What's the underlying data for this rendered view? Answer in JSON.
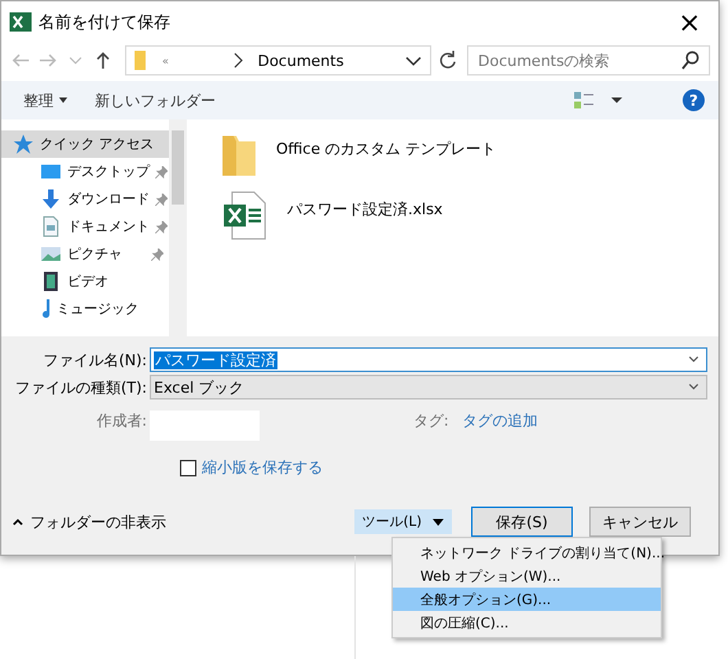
{
  "window": {
    "title": "名前を付けて保存",
    "close": "×"
  },
  "address": {
    "prefix": "«",
    "path": "Documents"
  },
  "search": {
    "placeholder": "Documentsの検索"
  },
  "toolbar": {
    "organize": "整理",
    "new_folder": "新しいフォルダー",
    "help": "?"
  },
  "sidebar": {
    "items": [
      {
        "label": "クイック アクセス",
        "kind": "star",
        "selected": true,
        "pinned": false
      },
      {
        "label": "デスクトップ",
        "kind": "desktop",
        "selected": false,
        "pinned": true
      },
      {
        "label": "ダウンロード",
        "kind": "download",
        "selected": false,
        "pinned": true
      },
      {
        "label": "ドキュメント",
        "kind": "document",
        "selected": false,
        "pinned": true
      },
      {
        "label": "ピクチャ",
        "kind": "picture",
        "selected": false,
        "pinned": true
      },
      {
        "label": "ビデオ",
        "kind": "video",
        "selected": false,
        "pinned": false
      },
      {
        "label": "ミュージック",
        "kind": "music",
        "selected": false,
        "pinned": false
      }
    ]
  },
  "files": [
    {
      "name": "Office のカスタム テンプレート",
      "kind": "folder"
    },
    {
      "name": "パスワード設定済.xlsx",
      "kind": "excel"
    }
  ],
  "form": {
    "filename_label": "ファイル名(N):",
    "filename": "パスワード設定済",
    "filetype_label": "ファイルの種類(T):",
    "filetype": "Excel ブック",
    "author_label": "作成者:",
    "tags_label": "タグ:",
    "tags_link": "タグの追加",
    "thumbnail": {
      "label": "縮小版を保存する",
      "checked": false
    }
  },
  "footer": {
    "hide_folders": "フォルダーの非表示",
    "tools": "ツール(L)",
    "save": "保存(S)",
    "cancel": "キャンセル"
  },
  "tools_menu": [
    {
      "label": "ネットワーク ドライブの割り当て(N)...",
      "selected": false
    },
    {
      "label": "Web オプション(W)...",
      "selected": false
    },
    {
      "label": "全般オプション(G)...",
      "selected": true
    },
    {
      "label": "図の圧縮(C)...",
      "selected": false
    }
  ]
}
